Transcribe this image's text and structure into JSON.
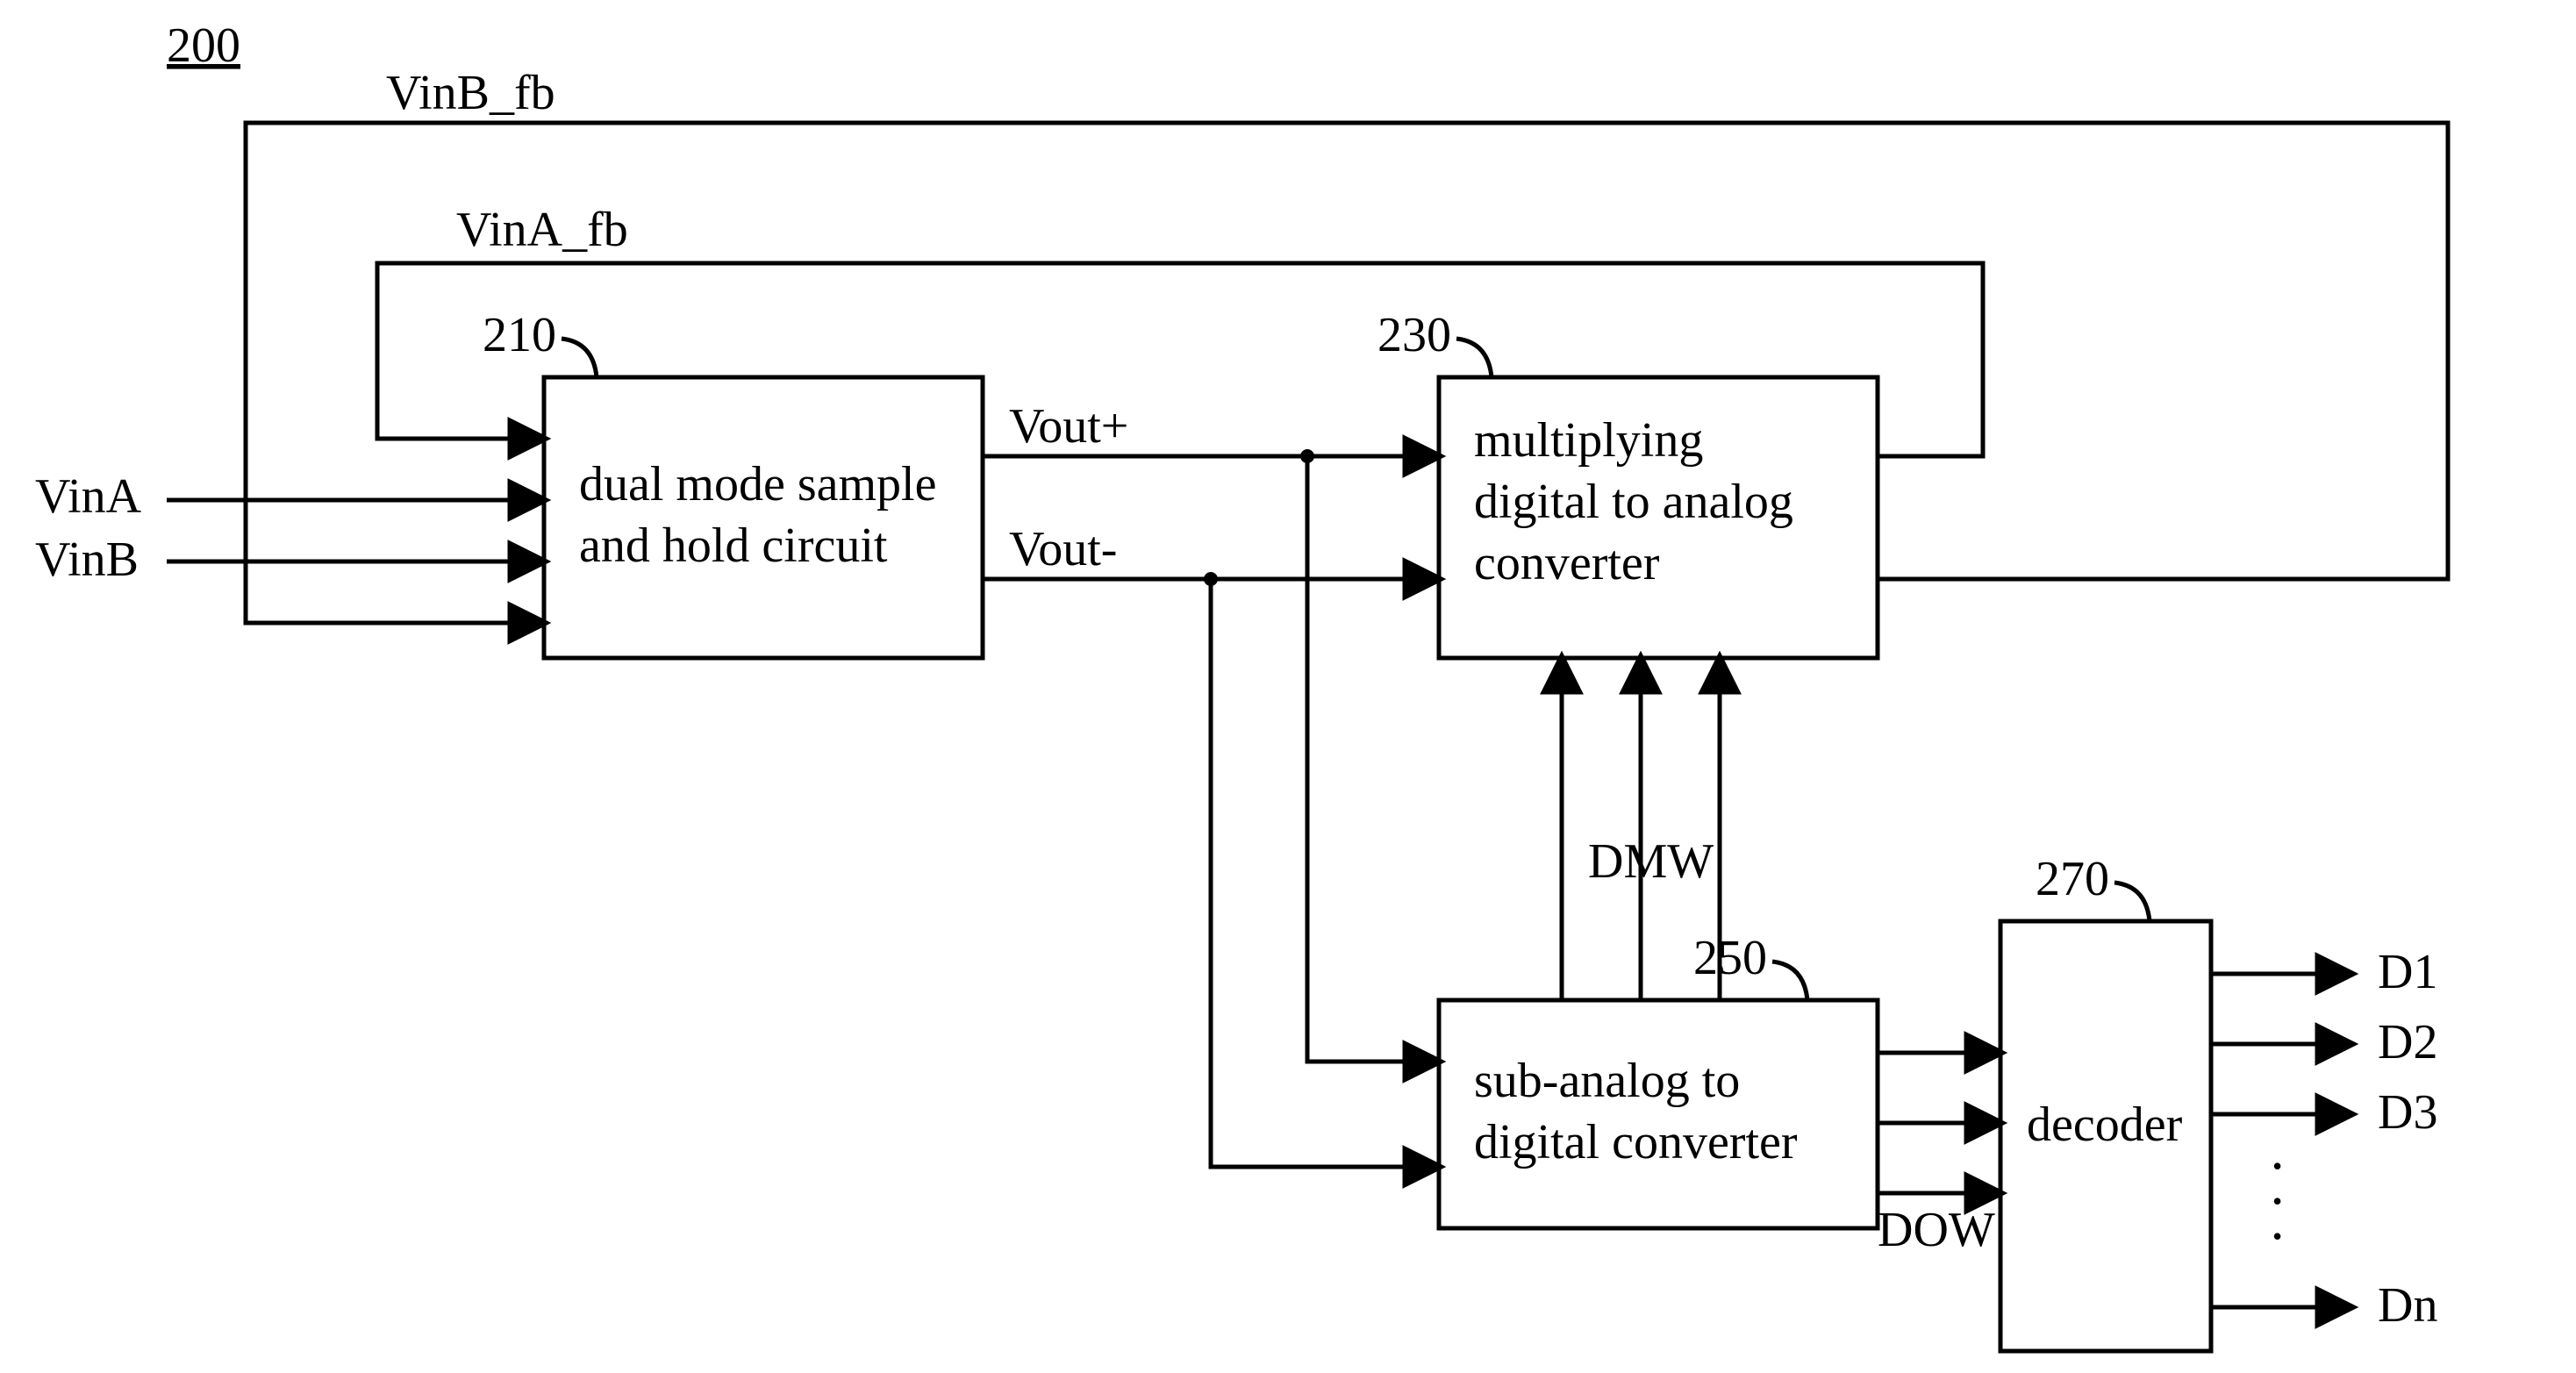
{
  "diagram": {
    "figure_ref": "200",
    "feedback_top_label": "VinB_fb",
    "feedback_mid_label": "VinA_fb",
    "input_top": "VinA",
    "input_bot": "VinB",
    "block210": {
      "ref": "210",
      "line1": "dual mode sample",
      "line2": "and hold circuit"
    },
    "vout_plus": "Vout+",
    "vout_minus": "Vout-",
    "block230": {
      "ref": "230",
      "line1": "multiplying",
      "line2": "digital to analog",
      "line3": "converter"
    },
    "dmw_label": "DMW",
    "block250": {
      "ref": "250",
      "line1": "sub-analog to",
      "line2": "digital converter"
    },
    "dow_label": "DOW",
    "block270": {
      "ref": "270",
      "text": "decoder"
    },
    "outputs": {
      "d1": "D1",
      "d2": "D2",
      "d3": "D3",
      "dn": "Dn"
    }
  }
}
